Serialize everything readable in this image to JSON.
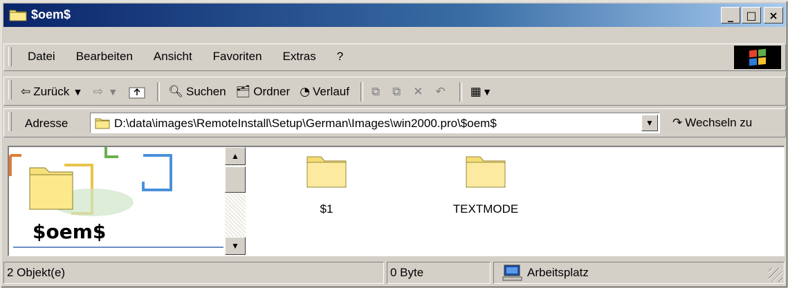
{
  "window": {
    "title": "$oem$"
  },
  "title_buttons": {
    "minimize": "_",
    "maximize": "□",
    "close": "×"
  },
  "menu": [
    "Datei",
    "Bearbeiten",
    "Ansicht",
    "Favoriten",
    "Extras",
    "?"
  ],
  "toolbar": {
    "back": "Zurück",
    "search": "Suchen",
    "folders": "Ordner",
    "history": "Verlauf"
  },
  "address": {
    "label": "Adresse",
    "value": "D:\\data\\images\\RemoteInstall\\Setup\\German\\Images\\win2000.pro\\$oem$",
    "go": "Wechseln zu"
  },
  "left_pane": {
    "title": "$oem$"
  },
  "items": [
    {
      "name": "$1"
    },
    {
      "name": "TEXTMODE"
    }
  ],
  "status": {
    "objects": "2 Objekt(e)",
    "size": "0 Byte",
    "zone": "Arbeitsplatz"
  },
  "colors": {
    "title_start": "#0a246a",
    "title_end": "#a6caf0",
    "folder": "#f6e89a"
  }
}
